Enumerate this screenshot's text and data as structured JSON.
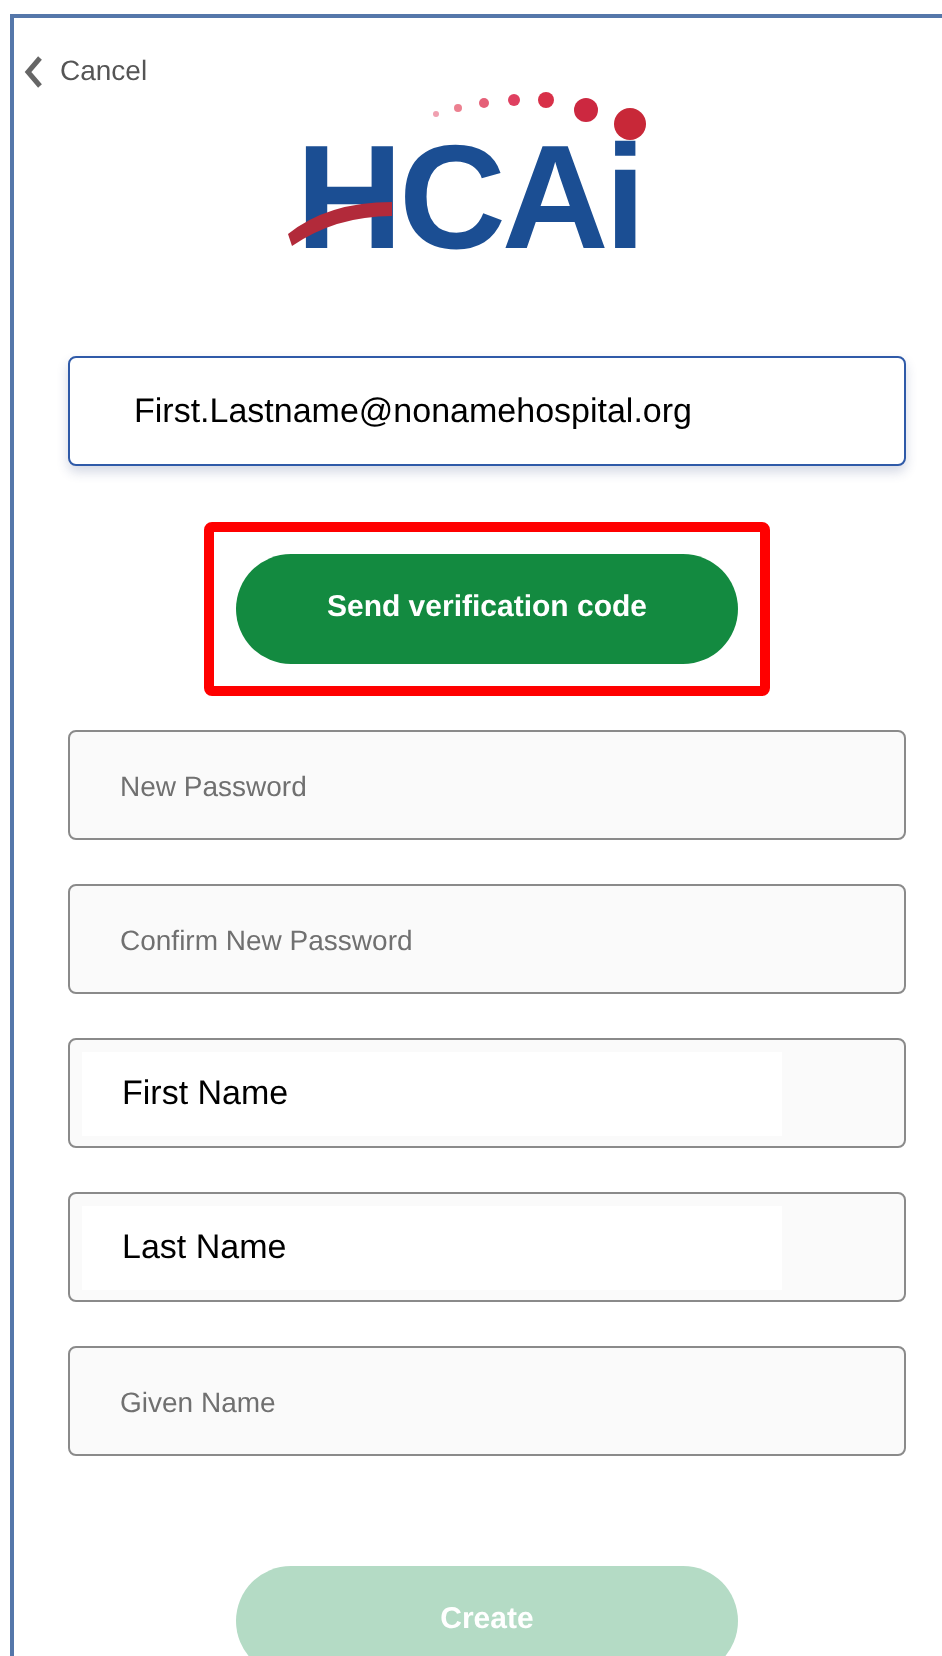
{
  "cancel": {
    "label": "Cancel"
  },
  "logo": {
    "text": "HCAi"
  },
  "email": {
    "value": "First.Lastname@nonamehospital.org",
    "focused": true
  },
  "send_button": {
    "label": "Send verification code",
    "highlighted": true,
    "disabled": false
  },
  "fields": [
    {
      "kind": "placeholder",
      "placeholder": "New Password"
    },
    {
      "kind": "placeholder",
      "placeholder": "Confirm New Password"
    },
    {
      "kind": "value",
      "value": "First Name"
    },
    {
      "kind": "value",
      "value": "Last Name"
    },
    {
      "kind": "placeholder",
      "placeholder": "Given Name"
    }
  ],
  "create_button": {
    "label": "Create",
    "disabled": true
  }
}
